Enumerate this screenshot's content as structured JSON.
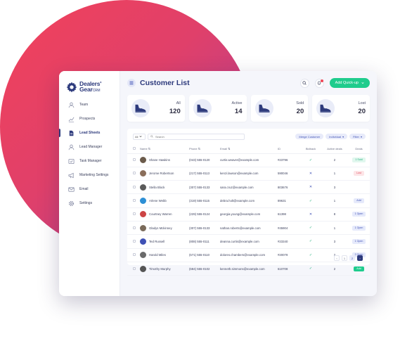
{
  "colors": {
    "brand": "#2d3a7c",
    "accent": "#1fcc8d",
    "danger": "#e04a5a",
    "blob_start": "#f2425a",
    "blob_end": "#a43e9e"
  },
  "logo": {
    "line1": "Dealers'",
    "line2": "Gear",
    "line2_suffix": "CRM"
  },
  "sidebar": {
    "items": [
      {
        "label": "Team",
        "icon": "user-icon",
        "active": false
      },
      {
        "label": "Prospects",
        "icon": "chart-icon",
        "active": false
      },
      {
        "label": "Lead Sheets",
        "icon": "document-icon",
        "active": true
      },
      {
        "label": "Lead Manager",
        "icon": "user-icon",
        "active": false
      },
      {
        "label": "Task Manager",
        "icon": "task-icon",
        "active": false
      },
      {
        "label": "Marketing Settings",
        "icon": "megaphone-icon",
        "active": false
      },
      {
        "label": "Email",
        "icon": "mail-icon",
        "active": false
      },
      {
        "label": "Settings",
        "icon": "gear-icon",
        "active": false
      }
    ]
  },
  "header": {
    "title": "Customer List",
    "quick_button": "Add Quick-up"
  },
  "stats": [
    {
      "label": "All",
      "value": "120"
    },
    {
      "label": "Active",
      "value": "14"
    },
    {
      "label": "Sold",
      "value": "20"
    },
    {
      "label": "Lost",
      "value": "20"
    }
  ],
  "toolbar": {
    "select_label": "All",
    "search_placeholder": "Search",
    "merge_label": "Merge Customer",
    "individual_label": "Individual",
    "filter_label": "Filter"
  },
  "table": {
    "columns": [
      "Name",
      "Phone",
      "Email",
      "ID",
      "Bidback",
      "Active deals",
      "Deals"
    ],
    "rows": [
      {
        "name": "Shane Hawkins",
        "phone": "(043) 555-0120",
        "email": "curtis.weaver@example.com",
        "id": "#23796",
        "bidback": "check",
        "active": "2",
        "deal": "1 Sold",
        "deal_style": "green"
      },
      {
        "name": "Jerome Robertson",
        "phone": "(217) 555-0113",
        "email": "kenzi.lawson@example.com",
        "id": "590046",
        "bidback": "cross",
        "active": "1",
        "deal": "Lost",
        "deal_style": "red"
      },
      {
        "name": "Stella Block",
        "phone": "(307) 555-0133",
        "email": "sara.cruz@example.com",
        "id": "803676",
        "bidback": "cross",
        "active": "3",
        "deal": "",
        "deal_style": ""
      },
      {
        "name": "Arlene Webb",
        "phone": "(319) 555-0115",
        "email": "debra.holt@example.com",
        "id": "89631",
        "bidback": "check",
        "active": "1",
        "deal": "Add",
        "deal_style": "blue-add"
      },
      {
        "name": "Courtney Warren",
        "phone": "(229) 555-0124",
        "email": "georgia.young@example.com",
        "id": "61398",
        "bidback": "cross",
        "active": "8",
        "deal": "1 Open",
        "deal_style": "blue"
      },
      {
        "name": "Gladys Mckinney",
        "phone": "(307) 555-0133",
        "email": "nathan.roberts@example.com",
        "id": "#45904",
        "bidback": "check",
        "active": "1",
        "deal": "1 Open",
        "deal_style": "blue"
      },
      {
        "name": "Ted Russell",
        "phone": "(808) 555-0111",
        "email": "deanna.curtis@example.com",
        "id": "#23340",
        "bidback": "check",
        "active": "3",
        "deal": "1 Open",
        "deal_style": "blue"
      },
      {
        "name": "Harold Miles",
        "phone": "(671) 555-0110",
        "email": "dolores.chambers@example.com",
        "id": "#20078",
        "bidback": "check",
        "active": "2",
        "deal": "2 Open",
        "deal_style": "blue"
      },
      {
        "name": "Timothy Murphy",
        "phone": "(684) 555-0102",
        "email": "kenneth.simmons@example.com",
        "id": "610708",
        "bidback": "check",
        "active": "2",
        "deal": "Add",
        "deal_style": "solid"
      }
    ]
  },
  "pagination": {
    "pages": [
      "1",
      "2"
    ]
  }
}
